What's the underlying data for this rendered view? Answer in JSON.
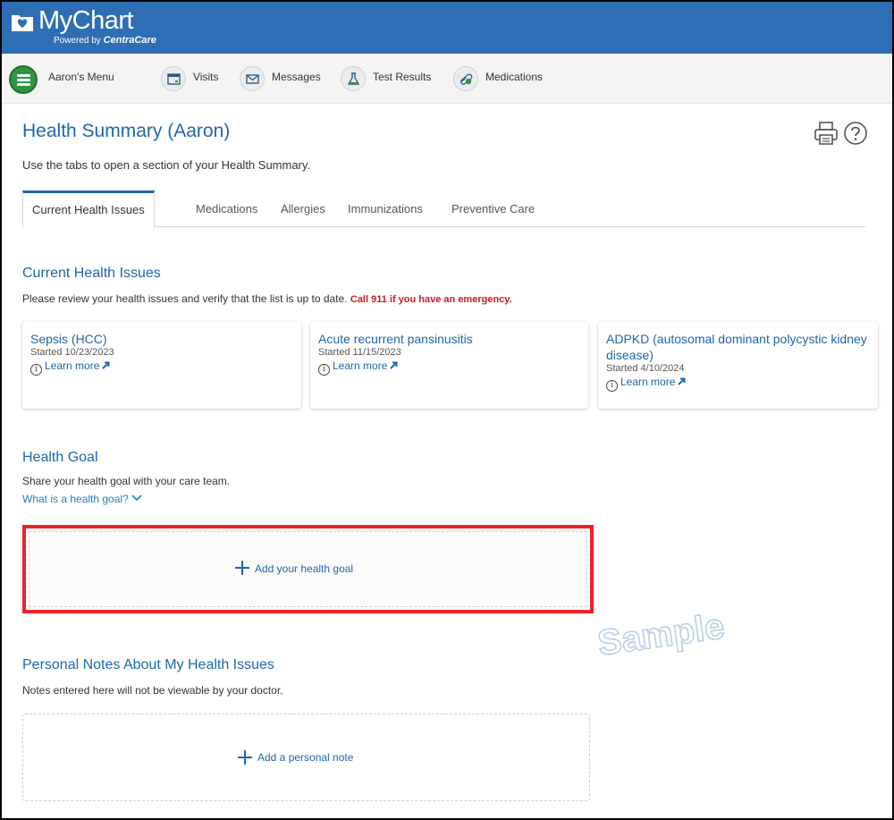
{
  "header": {
    "logo_text": "MyChart",
    "logo_sub_prefix": "Powered by",
    "logo_sub_brand": "CentraCare"
  },
  "nav": {
    "menu_label": "Aaron's Menu",
    "items": [
      {
        "label": "Visits",
        "icon": "calendar-icon"
      },
      {
        "label": "Messages",
        "icon": "envelope-icon"
      },
      {
        "label": "Test Results",
        "icon": "flask-icon"
      },
      {
        "label": "Medications",
        "icon": "pill-icon"
      }
    ]
  },
  "page": {
    "title": "Health Summary (Aaron)",
    "intro": "Use the tabs to open a section of your Health Summary.",
    "tabs": [
      {
        "label": "Current Health Issues",
        "active": true
      },
      {
        "label": "Medications",
        "active": false
      },
      {
        "label": "Allergies",
        "active": false
      },
      {
        "label": "Immunizations",
        "active": false
      },
      {
        "label": "Preventive Care",
        "active": false
      }
    ]
  },
  "issues_section": {
    "heading": "Current Health Issues",
    "description": "Please review your health issues and verify that the list is up to date.",
    "emergency": "Call 911 if you have an emergency.",
    "learn_more": "Learn more",
    "issues": [
      {
        "name": "Sepsis (HCC)",
        "started": "Started 10/23/2023"
      },
      {
        "name": "Acute recurrent pansinusitis",
        "started": "Started 11/15/2023"
      },
      {
        "name": "ADPKD (autosomal dominant polycystic kidney disease)",
        "started": "Started 4/10/2024"
      }
    ]
  },
  "goal_section": {
    "heading": "Health Goal",
    "description": "Share your health goal with your care team.",
    "link": "What is a health goal?",
    "add_label": "Add your health goal"
  },
  "notes_section": {
    "heading": "Personal Notes About My Health Issues",
    "description": "Notes entered here will not be viewable by your doctor.",
    "add_label": "Add a personal note"
  },
  "watermark": "Sample",
  "colors": {
    "header_blue": "#2e6eb5",
    "link_blue": "#1e66ad",
    "menu_green": "#2e9640",
    "emergency_red": "#d11a1a",
    "highlight_red": "#e8242a"
  }
}
